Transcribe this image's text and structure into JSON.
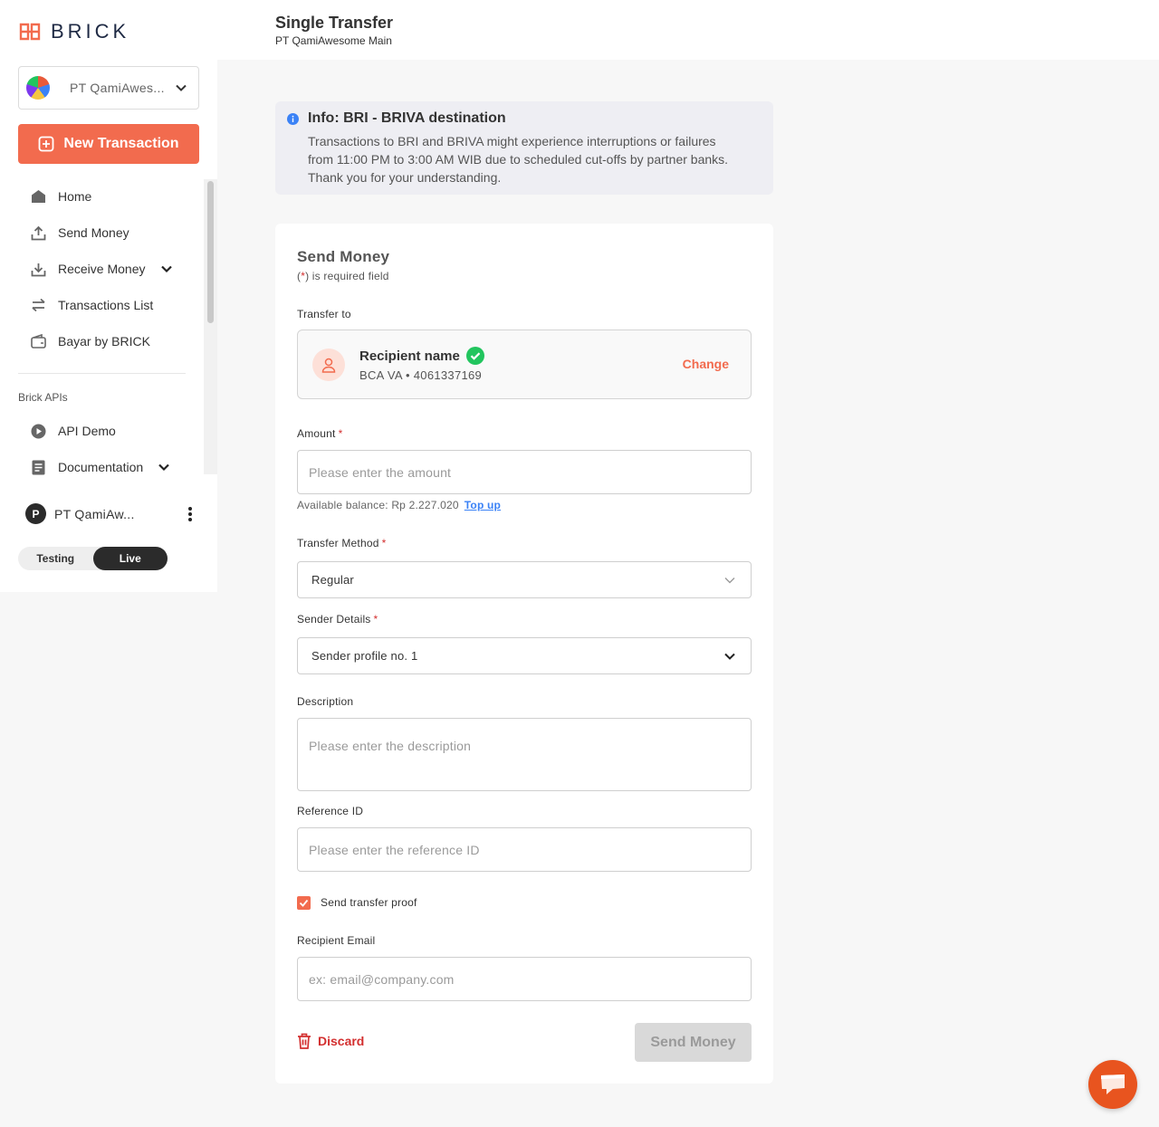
{
  "brand": {
    "logo_text": "BRICK",
    "accent_color": "#f26b4e"
  },
  "sidebar": {
    "company_name": "PT QamiAwes...",
    "new_transaction_label": "New Transaction",
    "nav_items": [
      {
        "label": "Home",
        "icon": "home-icon"
      },
      {
        "label": "Send Money",
        "icon": "upload-icon"
      },
      {
        "label": "Receive Money",
        "icon": "download-icon",
        "expandable": true
      },
      {
        "label": "Transactions List",
        "icon": "swap-arrows-icon"
      },
      {
        "label": "Bayar by BRICK",
        "icon": "wallet-icon"
      }
    ],
    "section_label": "Brick APIs",
    "api_items": [
      {
        "label": "API Demo",
        "icon": "play-circle-icon"
      },
      {
        "label": "Documentation",
        "icon": "document-icon",
        "expandable": true
      }
    ],
    "profile": {
      "initial": "P",
      "name": "PT QamiAw..."
    },
    "environment": {
      "options": [
        "Testing",
        "Live"
      ],
      "selected": "Live"
    }
  },
  "header": {
    "title": "Single Transfer",
    "subtitle": "PT QamiAwesome Main"
  },
  "info_banner": {
    "title": "Info: BRI - BRIVA destination",
    "body_line1": "Transactions to BRI and BRIVA might experience interruptions or failures",
    "body_line2": "from 11:00 PM to 3:00 AM WIB due to scheduled cut-offs by partner banks.",
    "body_line3": "Thank you for your understanding."
  },
  "form": {
    "title": "Send Money",
    "required_note_star": "*",
    "required_note_text": ") is required field",
    "transfer_to_label": "Transfer to",
    "recipient": {
      "name": "Recipient name",
      "account": "BCA VA • 4061337169",
      "change_label": "Change"
    },
    "amount": {
      "label": "Amount",
      "placeholder": "Please enter the amount",
      "balance_text": "Available balance: Rp 2.227.020",
      "topup_label": "Top up"
    },
    "transfer_method": {
      "label": "Transfer Method",
      "value": "Regular"
    },
    "sender_details": {
      "label": "Sender Details",
      "value": "Sender profile no. 1"
    },
    "description": {
      "label": "Description",
      "placeholder": "Please enter the description"
    },
    "reference_id": {
      "label": "Reference ID",
      "placeholder": "Please enter the reference ID"
    },
    "send_proof": {
      "label": "Send transfer proof",
      "checked": true
    },
    "recipient_email": {
      "label": "Recipient Email",
      "placeholder": "ex: email@company.com"
    },
    "discard_label": "Discard",
    "submit_label": "Send Money"
  }
}
